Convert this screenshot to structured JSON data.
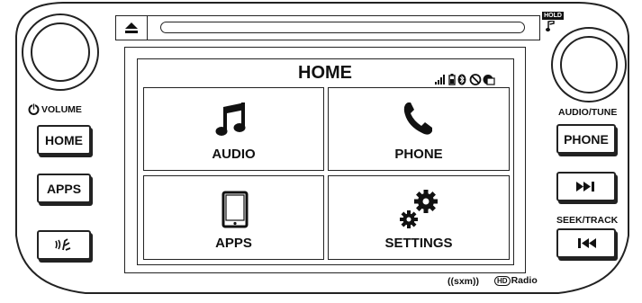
{
  "left_panel": {
    "volume_label": "VOLUME",
    "buttons": {
      "home": "HOME",
      "apps": "APPS"
    }
  },
  "right_panel": {
    "hold_badge": "HOLD",
    "audio_tune_label": "AUDIO/TUNE",
    "phone_button": "PHONE",
    "seek_track_label": "SEEK/TRACK"
  },
  "screen": {
    "title": "HOME",
    "status_icons": [
      "signal-bars-icon",
      "battery-icon",
      "bluetooth-icon",
      "mute-icon",
      "media-icon"
    ],
    "tiles": [
      {
        "id": "audio",
        "label": "AUDIO",
        "icon": "music-note-icon"
      },
      {
        "id": "phone",
        "label": "PHONE",
        "icon": "phone-handset-icon"
      },
      {
        "id": "apps",
        "label": "APPS",
        "icon": "tablet-icon"
      },
      {
        "id": "settings",
        "label": "SETTINGS",
        "icon": "gears-icon"
      }
    ]
  },
  "branding": {
    "sxm": "((sxm))",
    "hd_radio": "Radio",
    "hd_letters": "HD"
  }
}
